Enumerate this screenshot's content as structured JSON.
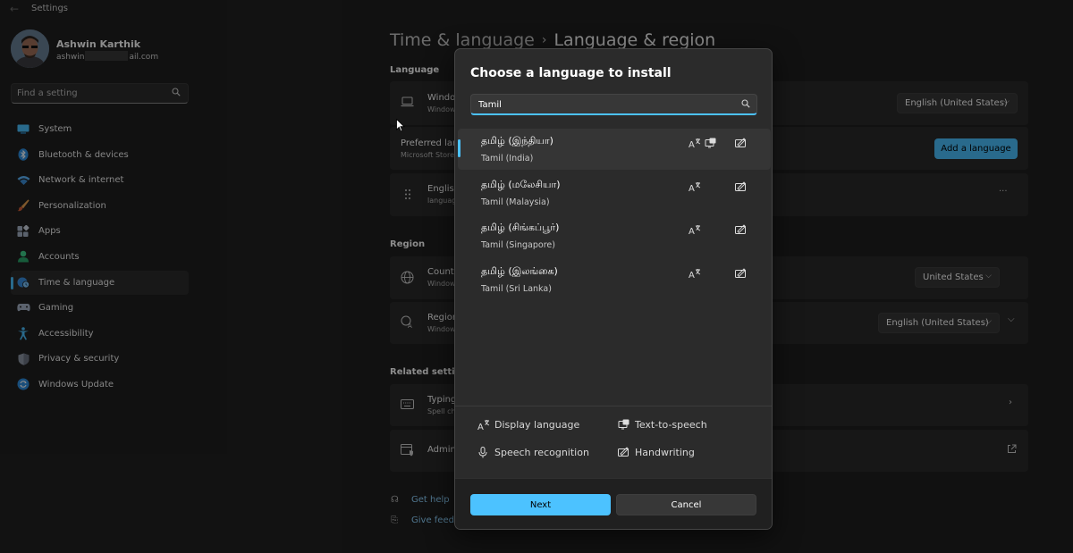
{
  "window": {
    "title": "Settings"
  },
  "user": {
    "name": "Ashwin Karthik",
    "email_start": "ashwin",
    "email_end": "ail.com"
  },
  "sidebar": {
    "search_placeholder": "Find a setting",
    "items": [
      {
        "label": "System",
        "icon": "monitor-icon"
      },
      {
        "label": "Bluetooth & devices",
        "icon": "bluetooth-icon"
      },
      {
        "label": "Network & internet",
        "icon": "wifi-icon"
      },
      {
        "label": "Personalization",
        "icon": "brush-icon"
      },
      {
        "label": "Apps",
        "icon": "apps-icon"
      },
      {
        "label": "Accounts",
        "icon": "person-icon"
      },
      {
        "label": "Time & language",
        "icon": "globe-clock-icon",
        "active": true
      },
      {
        "label": "Gaming",
        "icon": "gamepad-icon"
      },
      {
        "label": "Accessibility",
        "icon": "accessibility-icon"
      },
      {
        "label": "Privacy & security",
        "icon": "shield-icon"
      },
      {
        "label": "Windows Update",
        "icon": "update-icon"
      }
    ]
  },
  "main": {
    "breadcrumb_parent": "Time & language",
    "breadcrumb_sep": "›",
    "breadcrumb_current": "Language & region",
    "language_section": "Language",
    "display_lang": {
      "title": "Windo",
      "sub": "Window",
      "value": "English (United States)"
    },
    "preferred": {
      "title": "Preferred lang",
      "sub": "Microsoft Store",
      "button": "Add a language"
    },
    "english_row": {
      "title": "English",
      "sub": "languag",
      "more": "···"
    },
    "region_section": "Region",
    "country": {
      "title": "Countr",
      "sub": "Window",
      "value": "United States"
    },
    "regional_format": {
      "title": "Region",
      "sub": "Window",
      "value": "English (United States)"
    },
    "related_section": "Related settings",
    "typing": {
      "title": "Typing",
      "sub": "Spell ch"
    },
    "admin": {
      "title": "Admin"
    },
    "get_help": "Get help",
    "give_feedback": "Give feedb"
  },
  "dialog": {
    "title": "Choose a language to install",
    "search_value": "Tamil",
    "languages": [
      {
        "native": "தமிழ் (இந்தியா)",
        "english": "Tamil (India)",
        "selected": true,
        "features": [
          "display-language",
          "text-to-speech",
          "handwriting"
        ]
      },
      {
        "native": "தமிழ் (மலேசியா)",
        "english": "Tamil (Malaysia)",
        "features": [
          "display-language",
          "handwriting"
        ]
      },
      {
        "native": "தமிழ் (சிங்கப்பூர்)",
        "english": "Tamil (Singapore)",
        "features": [
          "display-language",
          "handwriting"
        ]
      },
      {
        "native": "தமிழ் (இலங்கை)",
        "english": "Tamil (Sri Lanka)",
        "features": [
          "display-language",
          "handwriting"
        ]
      }
    ],
    "legend": {
      "display_language": "Display language",
      "text_to_speech": "Text-to-speech",
      "speech_recognition": "Speech recognition",
      "handwriting": "Handwriting"
    },
    "next": "Next",
    "cancel": "Cancel"
  },
  "colors": {
    "accent": "#4cc2ff",
    "background": "#202020",
    "card": "#2b2b2b"
  }
}
